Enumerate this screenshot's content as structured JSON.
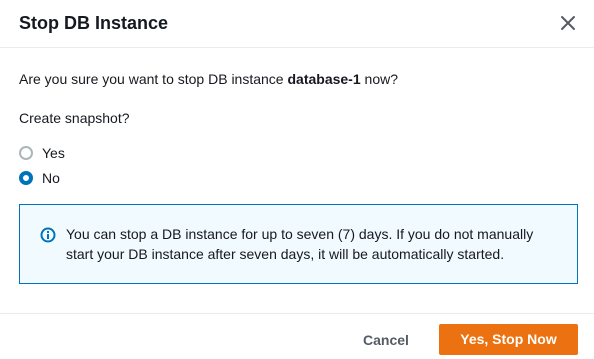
{
  "dialog": {
    "title": "Stop DB Instance",
    "close_icon": "close-icon"
  },
  "body": {
    "confirm_prefix": "Are you sure you want to stop DB instance ",
    "instance_name": "database-1",
    "confirm_suffix": " now?",
    "snapshot_label": "Create snapshot?",
    "options": [
      {
        "label": "Yes",
        "checked": false
      },
      {
        "label": "No",
        "checked": true
      }
    ],
    "info": {
      "icon": "info-icon",
      "text": "You can stop a DB instance for up to seven (7) days. If you do not manually start your DB instance after seven days, it will be automatically started."
    }
  },
  "footer": {
    "cancel_label": "Cancel",
    "confirm_label": "Yes, Stop Now"
  },
  "colors": {
    "accent": "#0073bb",
    "primary_button": "#ec7211",
    "info_background": "#f1faff"
  }
}
